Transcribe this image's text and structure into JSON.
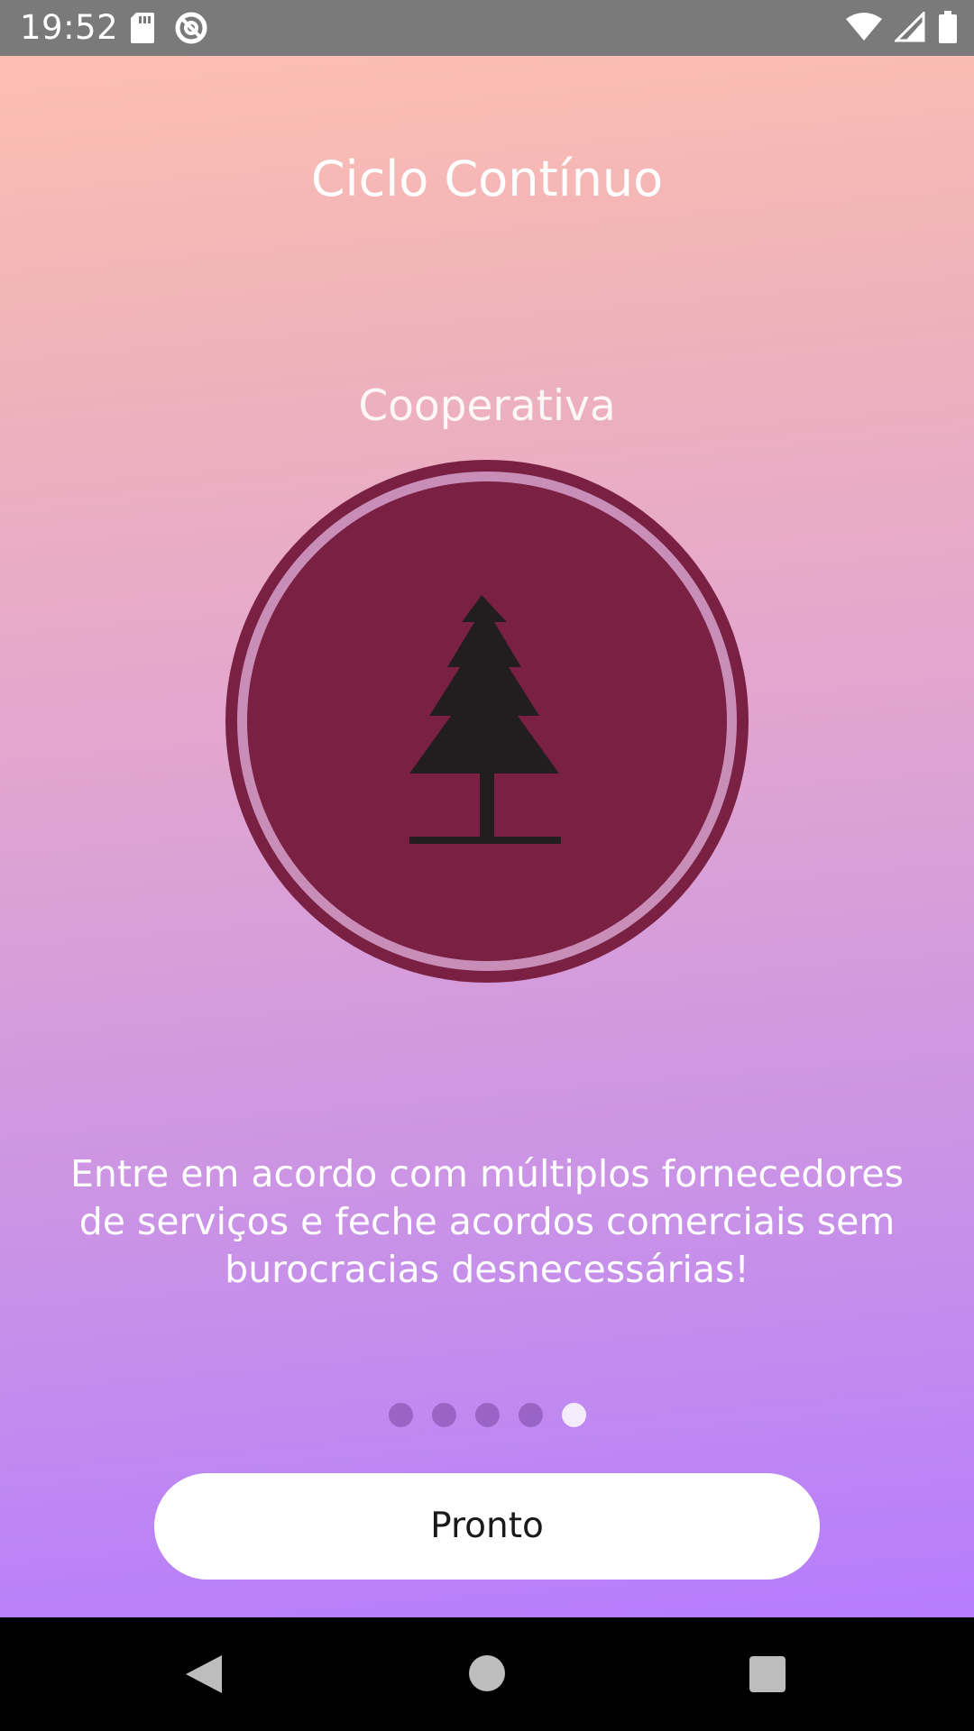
{
  "status_bar": {
    "time": "19:52",
    "left_icons": [
      "sd-card-icon",
      "data-saver-icon"
    ],
    "right_icons": [
      "wifi-icon",
      "cell-signal-icon",
      "battery-icon"
    ]
  },
  "onboarding": {
    "app_title": "Ciclo Contínuo",
    "slide_title": "Cooperativa",
    "icon": "tree-icon",
    "description": "Entre em acordo com múltiplos fornecedores de serviços e feche acordos comerciais sem burocracias desnecessárias!",
    "pager": {
      "total": 5,
      "current": 5
    },
    "done_label": "Pronto"
  },
  "nav_bar": {
    "buttons": [
      "back-icon",
      "home-icon",
      "recents-icon"
    ]
  },
  "colors": {
    "status_bar": "#7a7a7a",
    "emblem_fill": "#7a2043",
    "emblem_ring": "#c98eb8",
    "gradient_top": "#fdbfb1",
    "gradient_bottom": "#b67cfd",
    "button_bg": "#ffffff",
    "dot_active": "#f4ecfb"
  }
}
